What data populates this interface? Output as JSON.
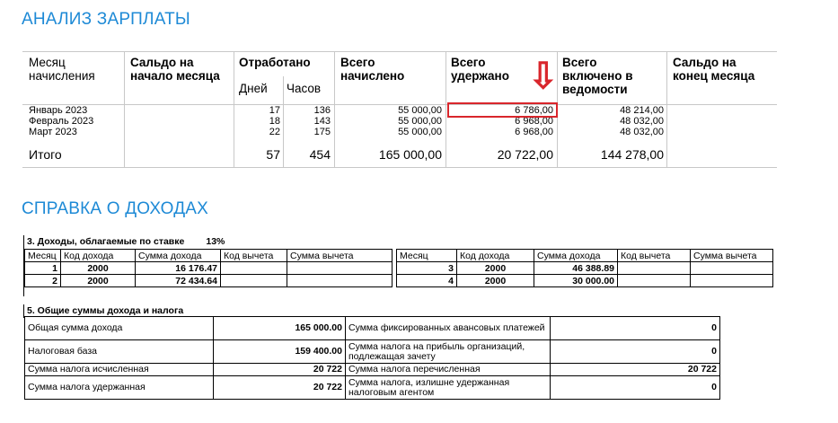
{
  "salary": {
    "title": "АНАЛИЗ ЗАРПЛАТЫ",
    "headers": {
      "month": [
        "Месяц",
        "начисления"
      ],
      "opening": [
        "Сальдо на",
        "начало месяца"
      ],
      "worked": "Отработано",
      "days": "Дней",
      "hours": "Часов",
      "accrued": [
        "Всего",
        "начислено"
      ],
      "withheld": [
        "Всего",
        "удержано"
      ],
      "payroll": [
        "Всего",
        "включено в",
        "ведомости"
      ],
      "closing": [
        "Сальдо на",
        "конец месяца"
      ]
    },
    "rows": [
      {
        "month": "Январь 2023",
        "days": "17",
        "hours": "136",
        "accrued": "55 000,00",
        "withheld": "6 786,00",
        "payroll": "48 214,00"
      },
      {
        "month": "Февраль 2023",
        "days": "18",
        "hours": "143",
        "accrued": "55 000,00",
        "withheld": "6 968,00",
        "payroll": "48 032,00"
      },
      {
        "month": "Март 2023",
        "days": "22",
        "hours": "175",
        "accrued": "55 000,00",
        "withheld": "6 968,00",
        "payroll": "48 032,00"
      }
    ],
    "total": {
      "label": "Итого",
      "days": "57",
      "hours": "454",
      "accrued": "165 000,00",
      "withheld": "20 722,00",
      "payroll": "144 278,00"
    },
    "arrow_glyph": "⇩",
    "highlight_color": "#d9262c"
  },
  "income": {
    "title": "СПРАВКА О ДОХОДАХ",
    "section3": {
      "title": "3. Доходы, облагаемые по ставке",
      "rate": "13%",
      "columns": [
        "Месяц",
        "Код дохода",
        "Сумма дохода",
        "Код вычета",
        "Сумма вычета"
      ],
      "left_rows": [
        {
          "month": "1",
          "code": "2000",
          "amount": "16 176.47"
        },
        {
          "month": "2",
          "code": "2000",
          "amount": "72 434.64"
        }
      ],
      "right_rows": [
        {
          "month": "3",
          "code": "2000",
          "amount": "46 388.89"
        },
        {
          "month": "4",
          "code": "2000",
          "amount": "30 000.00"
        }
      ]
    },
    "section5": {
      "title": "5. Общие суммы дохода и налога",
      "rows": [
        {
          "l_label": "Общая сумма дохода",
          "l_value": "165 000.00",
          "r_label": "Сумма фиксированных авансовых платежей",
          "r_value": "0"
        },
        {
          "l_label": "Налоговая база",
          "l_value": "159 400.00",
          "r_label": "Сумма налога на прибыль организаций, подлежащая зачету",
          "r_value": "0"
        },
        {
          "l_label": "Сумма налога исчисленная",
          "l_value": "20 722",
          "r_label": "Сумма налога перечисленная",
          "r_value": "20 722"
        },
        {
          "l_label": "Сумма налога удержанная",
          "l_value": "20 722",
          "r_label": "Сумма налога, излишне удержанная налоговым агентом",
          "r_value": "0"
        }
      ]
    }
  }
}
